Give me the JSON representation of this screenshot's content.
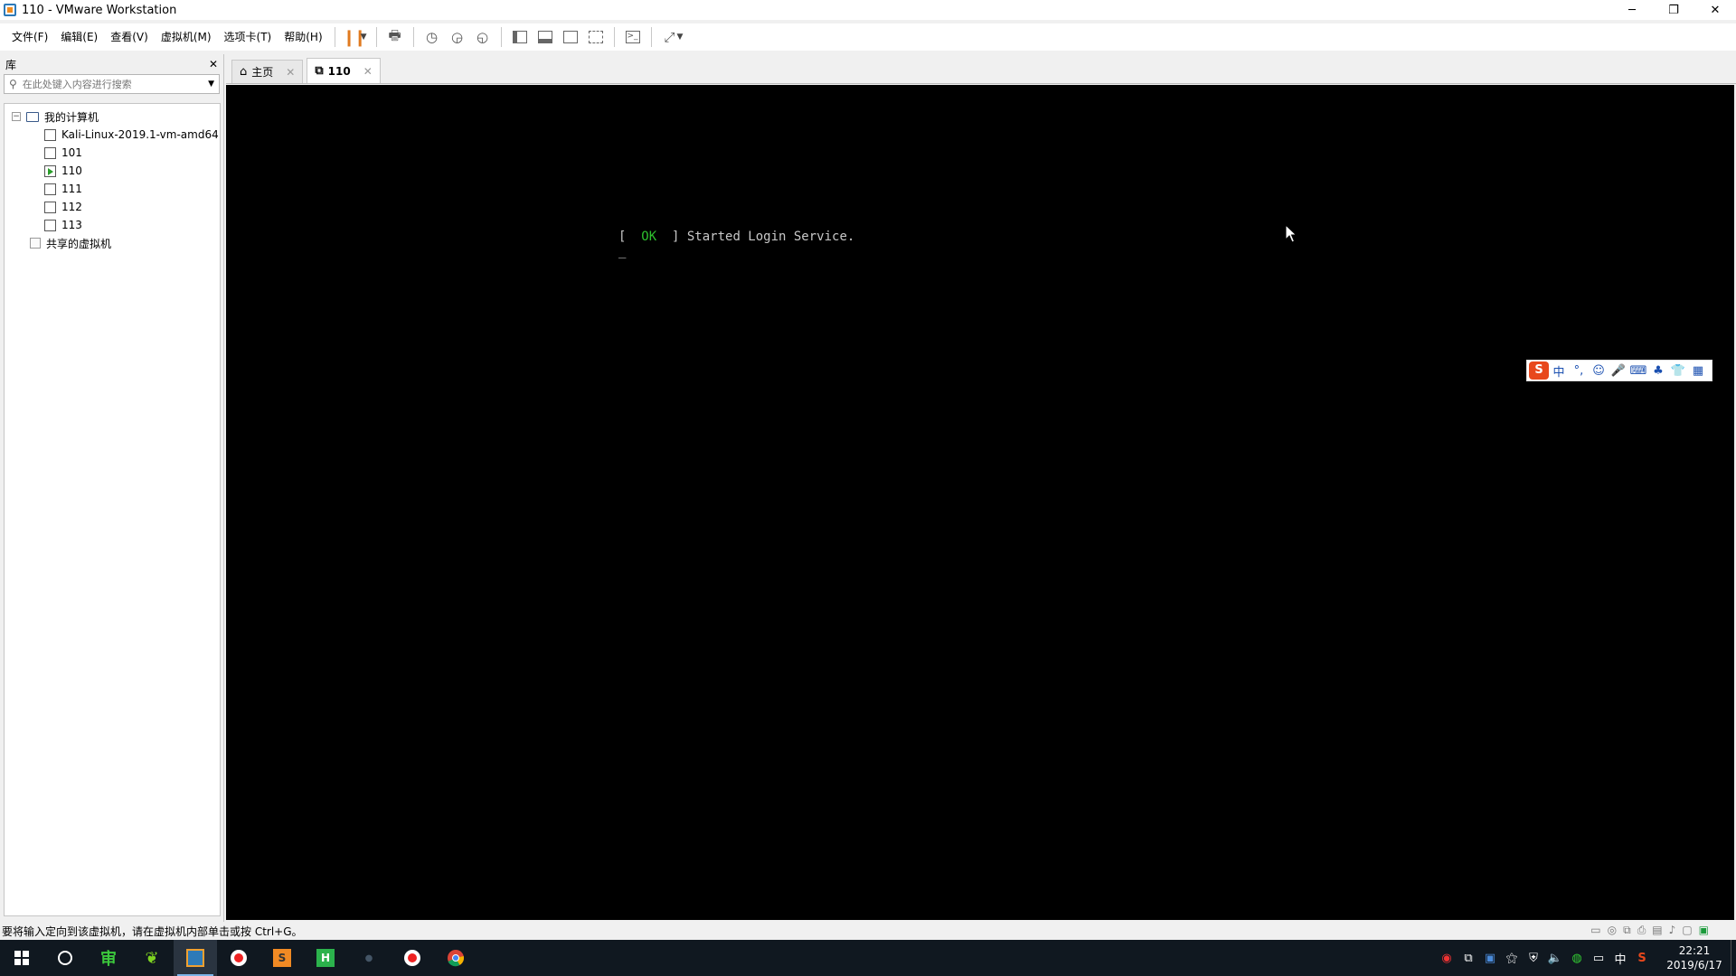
{
  "window": {
    "title": "110 - VMware Workstation",
    "controls": {
      "minimize": "─",
      "restore": "❐",
      "close": "✕"
    }
  },
  "menu": {
    "file": "文件(F)",
    "edit": "编辑(E)",
    "view": "查看(V)",
    "vm": "虚拟机(M)",
    "tabs": "选项卡(T)",
    "help": "帮助(H)"
  },
  "library": {
    "title": "库",
    "close": "✕",
    "search_placeholder": "在此处键入内容进行搜索",
    "tree": {
      "root": "我的计算机",
      "vms": [
        {
          "label": "Kali-Linux-2019.1-vm-amd64",
          "running": false
        },
        {
          "label": "101",
          "running": false
        },
        {
          "label": "110",
          "running": true
        },
        {
          "label": "111",
          "running": false
        },
        {
          "label": "112",
          "running": false
        },
        {
          "label": "113",
          "running": false
        }
      ],
      "shared": "共享的虚拟机"
    }
  },
  "tabs": [
    {
      "label": "主页",
      "close": "✕"
    },
    {
      "label": "110",
      "close": "✕"
    }
  ],
  "console": {
    "line1_open": "[",
    "line1_ok": "OK",
    "line1_rest": "] Started Login Service.",
    "line2": "_"
  },
  "ime": {
    "logo": "S",
    "items": [
      "中",
      "°,",
      "☺",
      "🎤",
      "⌨",
      "♣",
      "👕",
      "▦"
    ]
  },
  "status": {
    "message": "要将输入定向到该虚拟机，请在虚拟机内部单击或按 Ctrl+G。"
  },
  "taskbar": {
    "clock_time": "22:21",
    "clock_date": "2019/6/17",
    "tray_lang": "中",
    "sogou": "S"
  },
  "colors": {
    "ok_green": "#2ec02e",
    "pause_orange": "#e07a1f",
    "taskbar_bg": "#101820"
  }
}
